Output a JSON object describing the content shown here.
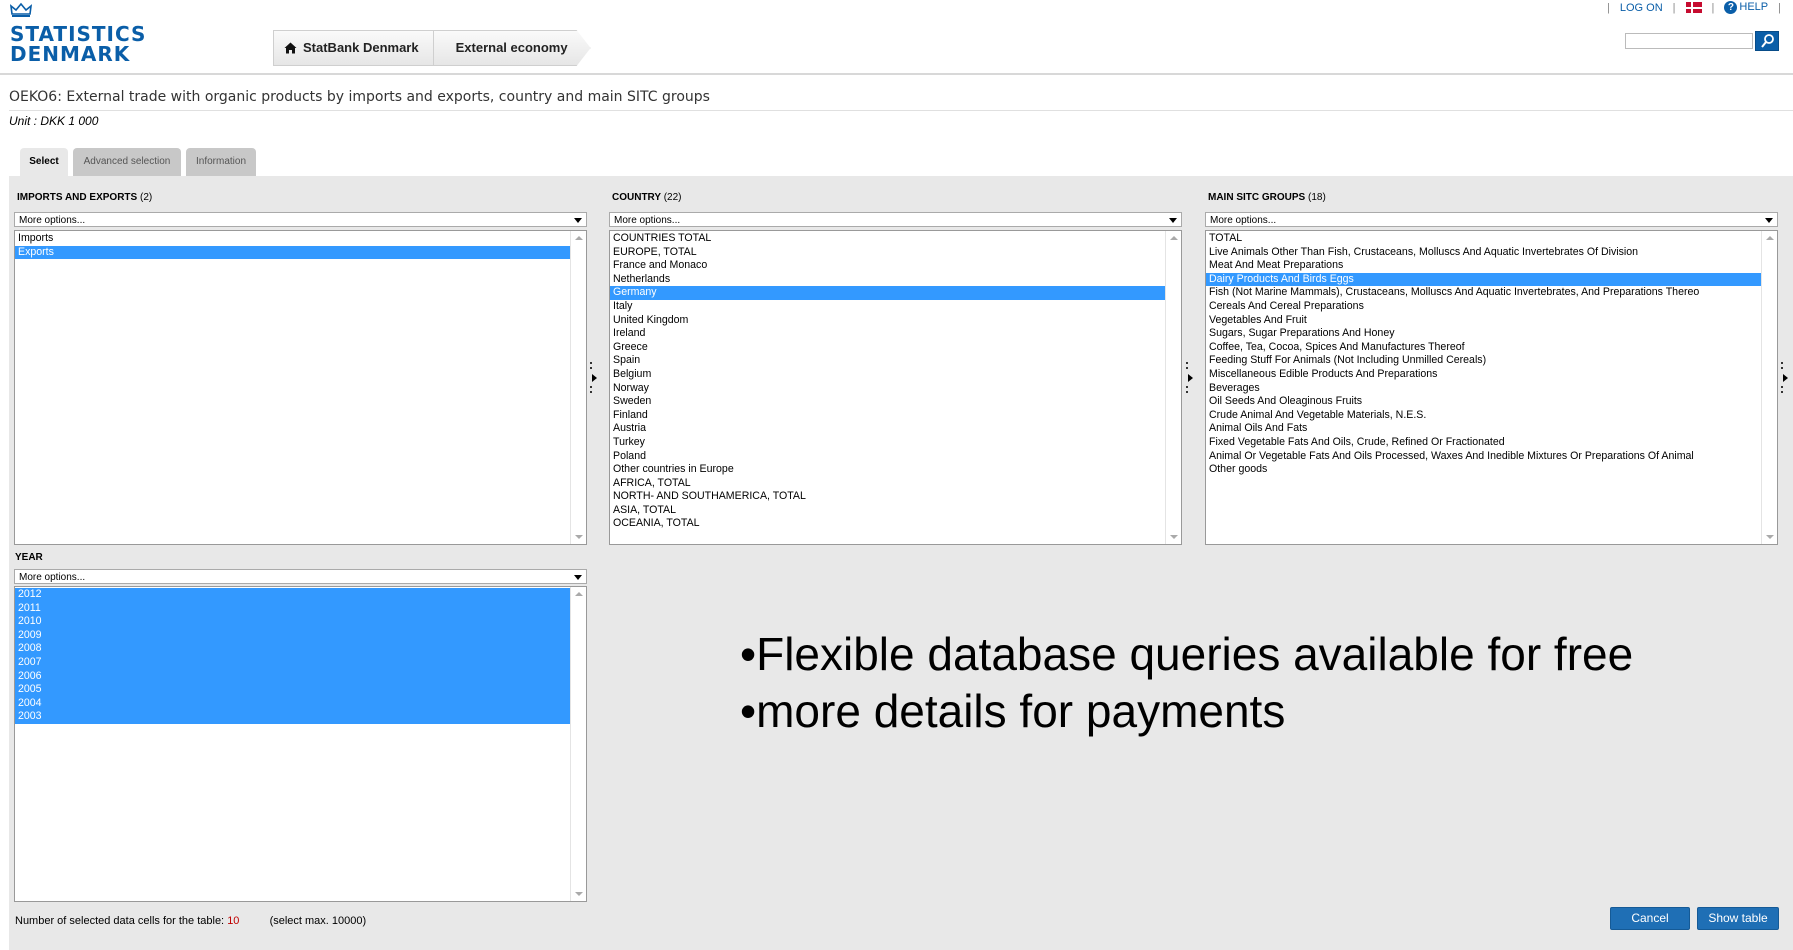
{
  "header": {
    "logo_line1": "STATISTICS",
    "logo_line2": "DENMARK",
    "breadcrumbs": [
      "StatBank Denmark",
      "External economy"
    ],
    "top_links": {
      "log_on": "LOG ON",
      "help": "HELP"
    },
    "search_placeholder": ""
  },
  "page": {
    "title": "OEKO6: External trade with organic products by imports and exports, country and main SITC groups",
    "unit": "Unit : DKK 1 000"
  },
  "tabs": [
    "Select",
    "Advanced selection",
    "Information"
  ],
  "variables": {
    "imports_exports": {
      "label": "IMPORTS AND EXPORTS",
      "count": "(2)",
      "dropdown": "More options...",
      "options": [
        "Imports",
        "Exports"
      ],
      "selected": [
        "Exports"
      ]
    },
    "country": {
      "label": "COUNTRY",
      "count": "(22)",
      "dropdown": "More options...",
      "options": [
        "COUNTRIES TOTAL",
        "EUROPE, TOTAL",
        "France and Monaco",
        "Netherlands",
        "Germany",
        "Italy",
        "United Kingdom",
        "Ireland",
        "Greece",
        "Spain",
        "Belgium",
        "Norway",
        "Sweden",
        "Finland",
        "Austria",
        "Turkey",
        "Poland",
        "Other countries in Europe",
        "AFRICA, TOTAL",
        "NORTH- AND SOUTHAMERICA, TOTAL",
        "ASIA, TOTAL",
        "OCEANIA, TOTAL"
      ],
      "selected": [
        "Germany"
      ]
    },
    "sitc": {
      "label": "MAIN SITC GROUPS",
      "count": "(18)",
      "dropdown": "More options...",
      "options": [
        "TOTAL",
        "Live Animals Other Than Fish, Crustaceans, Molluscs And Aquatic Invertebrates Of Division",
        "Meat And Meat Preparations",
        "Dairy Products And Birds Eggs",
        "Fish (Not Marine Mammals), Crustaceans, Molluscs And Aquatic Invertebrates, And Preparations Thereo",
        "Cereals And Cereal Preparations",
        "Vegetables And Fruit",
        "Sugars, Sugar Preparations And Honey",
        "Coffee, Tea, Cocoa, Spices And Manufactures Thereof",
        "Feeding Stuff For Animals (Not Including Unmilled Cereals)",
        "Miscellaneous Edible Products And Preparations",
        "Beverages",
        "Oil Seeds And Oleaginous Fruits",
        "Crude Animal And Vegetable Materials, N.E.S.",
        "Animal Oils And Fats",
        "Fixed Vegetable Fats And Oils, Crude, Refined Or Fractionated",
        "Animal Or Vegetable Fats And Oils Processed, Waxes And Inedible Mixtures Or Preparations Of Animal",
        "Other goods"
      ],
      "selected": [
        "Dairy Products And Birds Eggs"
      ]
    },
    "year": {
      "label": "YEAR",
      "count": "",
      "dropdown": "More options...",
      "options": [
        "2012",
        "2011",
        "2010",
        "2009",
        "2008",
        "2007",
        "2006",
        "2005",
        "2004",
        "2003"
      ],
      "selected": [
        "2012",
        "2011",
        "2010",
        "2009",
        "2008",
        "2007",
        "2006",
        "2005",
        "2004",
        "2003"
      ]
    }
  },
  "overlay": {
    "bullet1": "•Flexible database queries available for free",
    "bullet2": "•more details for payments"
  },
  "footer": {
    "cells_label": "Number of selected data cells for the table:",
    "cells_value": "10",
    "max_note": "(select max. 10000)",
    "cancel": "Cancel",
    "show_table": "Show table"
  },
  "colors": {
    "brand_blue": "#0a5ea8",
    "selection": "#3399ff",
    "panel_bg": "#e8e8e8",
    "button": "#1f6fb5",
    "count_red": "#c00000"
  },
  "icons": [
    "crown-icon",
    "home-icon",
    "flag-denmark-icon",
    "help-icon",
    "search-icon",
    "dropdown-arrow-icon",
    "scroll-up-icon",
    "scroll-down-icon",
    "grip-handle-icon"
  ]
}
